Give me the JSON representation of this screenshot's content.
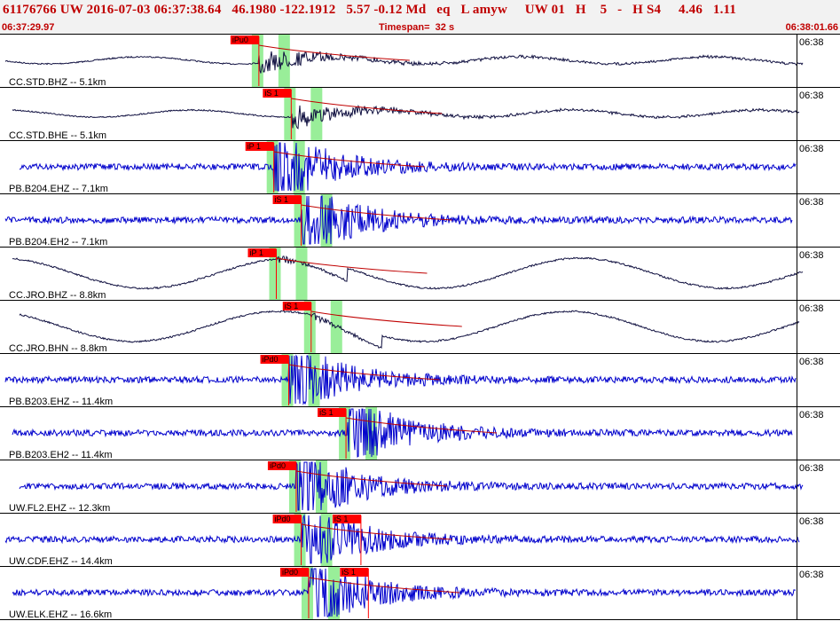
{
  "header": {
    "title": "61176766 UW 2016-07-03 06:37:38.64   46.1980 -122.1912   5.57 -0.12 Md   eq   L amyw     UW 01   H    5   -   H S4     4.46   1.11",
    "start_time": "06:37:29.97",
    "timespan": "Timespan=  32 s",
    "end_time": "06:38:01.66"
  },
  "colors": {
    "blue_trace": "#0000cc",
    "dark_trace": "#101040",
    "pick_box": "#ff0000",
    "window": "#99ee99",
    "coda": "#c00000"
  },
  "panels": [
    {
      "label": "CC.STD.BHZ -- 5.1km",
      "time": "06:38",
      "color": "dark",
      "style": "bb",
      "pick": "iPu0",
      "pick_time": 10.4
    },
    {
      "label": "CC.STD.BHE -- 5.1km",
      "time": "06:38",
      "color": "dark",
      "style": "bb",
      "pick": "iS 1",
      "pick_time": 11.7
    },
    {
      "label": "PB.B204.EHZ -- 7.1km",
      "time": "06:38",
      "color": "blue",
      "style": "sp",
      "pick": "iP 1",
      "pick_time": 11.0
    },
    {
      "label": "PB.B204.EH2 -- 7.1km",
      "time": "06:38",
      "color": "blue",
      "style": "sp",
      "pick": "iS 1",
      "pick_time": 12.1
    },
    {
      "label": "CC.JRO.BHZ -- 8.8km",
      "time": "06:38",
      "color": "dark",
      "style": "lp",
      "pick": "iP 1",
      "pick_time": 11.1
    },
    {
      "label": "CC.JRO.BHN -- 8.8km",
      "time": "06:38",
      "color": "dark",
      "style": "lp",
      "pick": "iS 1",
      "pick_time": 12.5
    },
    {
      "label": "PB.B203.EHZ -- 11.4km",
      "time": "06:38",
      "color": "blue",
      "style": "sp",
      "pick": "iPd0",
      "pick_time": 11.6
    },
    {
      "label": "PB.B203.EH2 -- 11.4km",
      "time": "06:38",
      "color": "blue",
      "style": "sp",
      "pick": "iS 1",
      "pick_time": 13.9
    },
    {
      "label": "UW.FL2.EHZ -- 12.3km",
      "time": "06:38",
      "color": "blue",
      "style": "sp",
      "pick": "iPd0",
      "pick_time": 11.9
    },
    {
      "label": "UW.CDF.EHZ -- 14.4km",
      "time": "06:38",
      "color": "blue",
      "style": "sp",
      "pick": "iPd0",
      "pick_time": 12.1,
      "pick2": "iS 1",
      "pick2_time": 14.5
    },
    {
      "label": "UW.ELK.EHZ -- 16.6km",
      "time": "06:38",
      "color": "blue",
      "style": "sp",
      "pick": "iPd0",
      "pick_time": 12.4,
      "pick2": "iS 1",
      "pick2_time": 14.8
    }
  ]
}
